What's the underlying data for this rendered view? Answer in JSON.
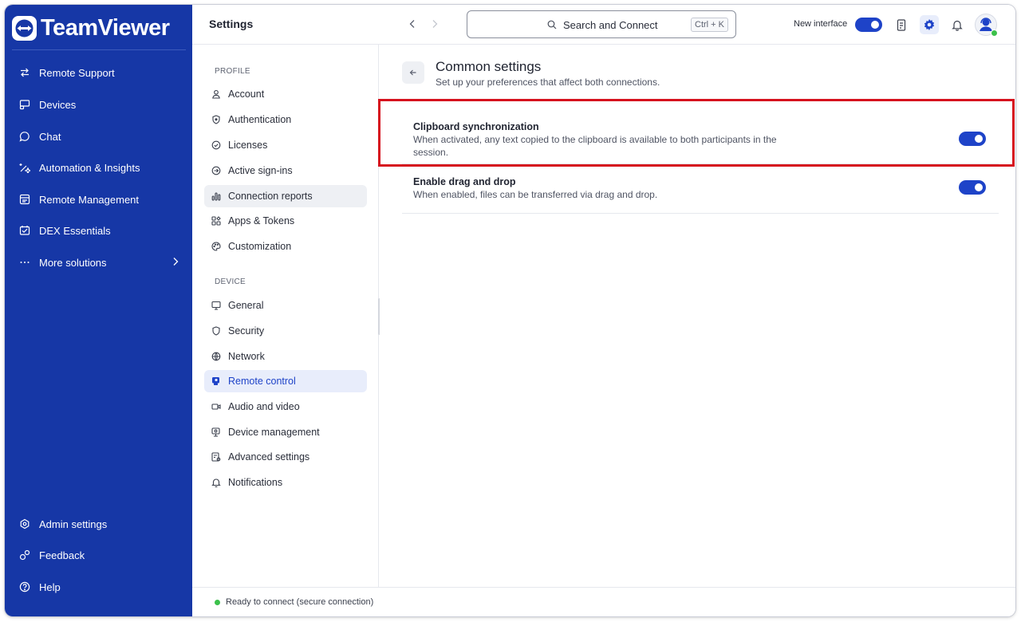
{
  "brand": {
    "name": "TeamViewer"
  },
  "nav": {
    "items": [
      {
        "label": "Remote Support",
        "icon": "arrows-swap-icon"
      },
      {
        "label": "Devices",
        "icon": "devices-icon"
      },
      {
        "label": "Chat",
        "icon": "chat-icon"
      },
      {
        "label": "Automation & Insights",
        "icon": "automation-icon"
      },
      {
        "label": "Remote Management",
        "icon": "remote-management-icon"
      },
      {
        "label": "DEX Essentials",
        "icon": "dex-icon"
      },
      {
        "label": "More solutions",
        "icon": "more-dots-icon"
      }
    ],
    "bottom": [
      {
        "label": "Admin settings",
        "icon": "admin-gear-icon"
      },
      {
        "label": "Feedback",
        "icon": "feedback-icon"
      },
      {
        "label": "Help",
        "icon": "help-icon"
      }
    ]
  },
  "header": {
    "title": "Settings",
    "search_label": "Search and Connect",
    "search_shortcut": "Ctrl + K",
    "new_interface_label": "New interface",
    "new_interface_on": true
  },
  "submenu": {
    "profile_label": "PROFILE",
    "profile_items": [
      {
        "label": "Account",
        "icon": "account-icon"
      },
      {
        "label": "Authentication",
        "icon": "shield-icon"
      },
      {
        "label": "Licenses",
        "icon": "license-check-icon"
      },
      {
        "label": "Active sign-ins",
        "icon": "sign-in-icon"
      },
      {
        "label": "Connection reports",
        "icon": "bar-chart-icon"
      },
      {
        "label": "Apps & Tokens",
        "icon": "apps-icon"
      },
      {
        "label": "Customization",
        "icon": "palette-icon"
      }
    ],
    "device_label": "DEVICE",
    "device_items": [
      {
        "label": "General",
        "icon": "monitor-icon"
      },
      {
        "label": "Security",
        "icon": "shield-icon"
      },
      {
        "label": "Network",
        "icon": "globe-icon"
      },
      {
        "label": "Remote control",
        "icon": "remote-control-icon"
      },
      {
        "label": "Audio and video",
        "icon": "video-icon"
      },
      {
        "label": "Device management",
        "icon": "device-management-icon"
      },
      {
        "label": "Advanced settings",
        "icon": "advanced-settings-icon"
      },
      {
        "label": "Notifications",
        "icon": "bell-icon"
      }
    ]
  },
  "main": {
    "title": "Common settings",
    "subtitle": "Set up your preferences that affect both connections.",
    "settings": [
      {
        "title": "Clipboard synchronization",
        "description": "When activated, any text copied to the clipboard is available to both participants in the session.",
        "enabled": true
      },
      {
        "title": "Enable drag and drop",
        "description": "When enabled, files can be transferred via drag and drop.",
        "enabled": true
      }
    ]
  },
  "status": {
    "text": "Ready to connect (secure connection)"
  },
  "colors": {
    "nav_bg": "#1637a6",
    "accent": "#1e43c8",
    "highlight": "#d6121e",
    "online": "#3cc14b"
  }
}
